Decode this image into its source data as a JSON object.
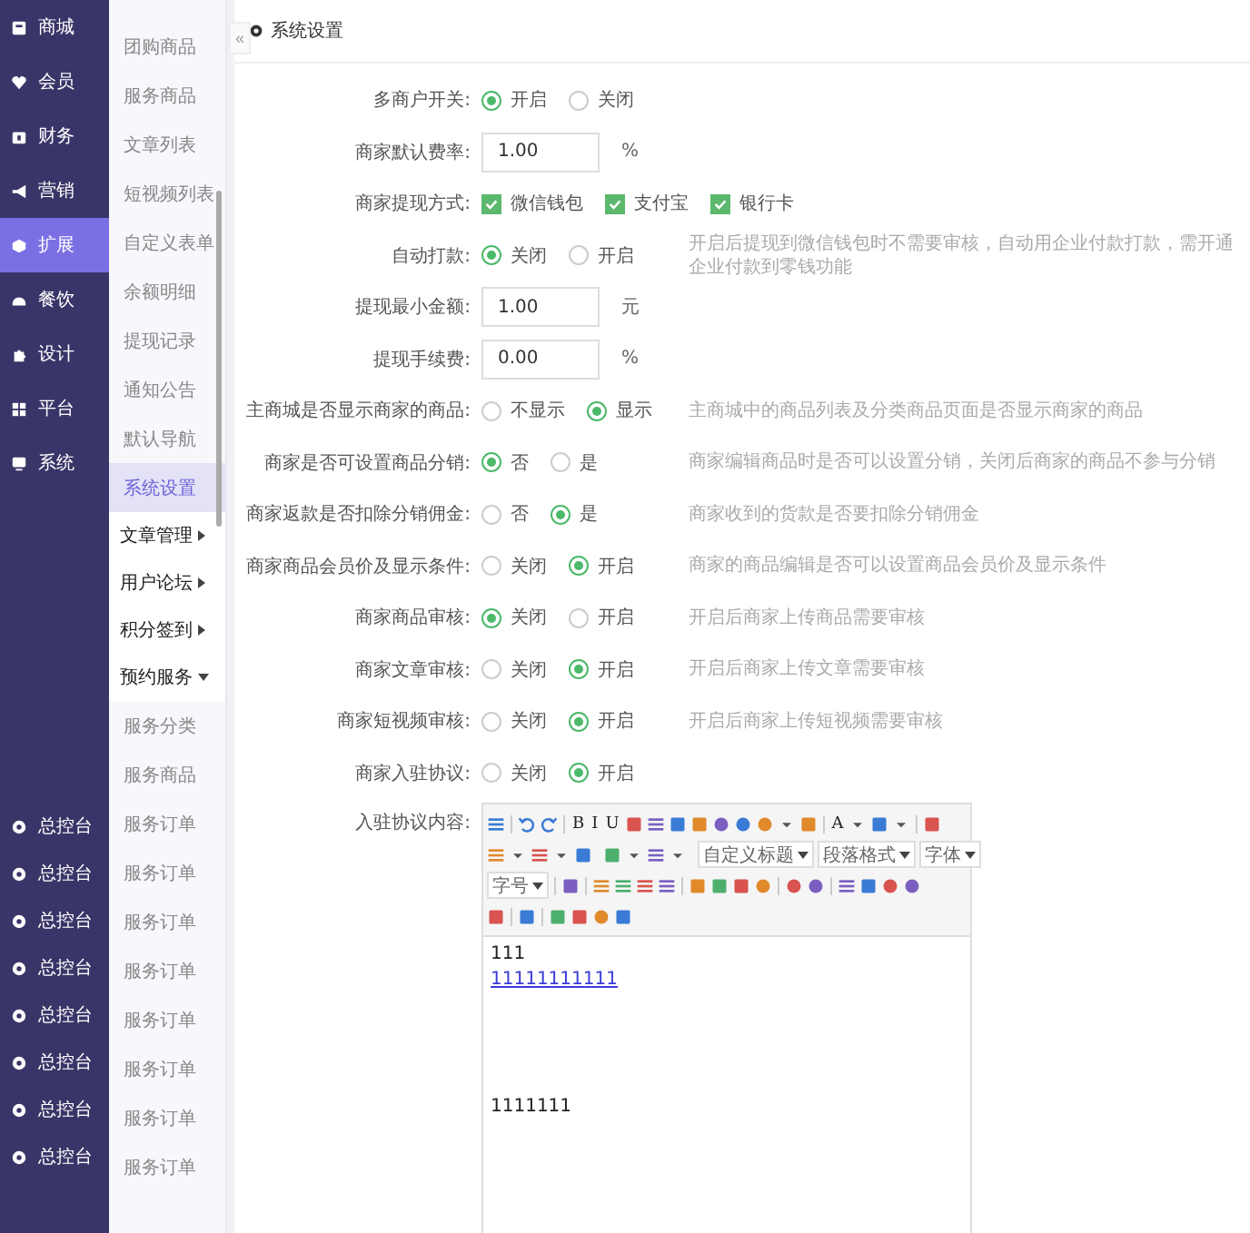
{
  "sidebar": {
    "items": [
      {
        "label": "商城",
        "selected": false
      },
      {
        "label": "会员",
        "selected": false
      },
      {
        "label": "财务",
        "selected": false
      },
      {
        "label": "营销",
        "selected": false
      },
      {
        "label": "扩展",
        "selected": true
      },
      {
        "label": "餐饮",
        "selected": false
      },
      {
        "label": "设计",
        "selected": false
      },
      {
        "label": "平台",
        "selected": false
      },
      {
        "label": "系统",
        "selected": false
      }
    ],
    "bottom_items": [
      {
        "label": "总控台"
      },
      {
        "label": "总控台"
      },
      {
        "label": "总控台"
      },
      {
        "label": "总控台"
      },
      {
        "label": "总控台"
      },
      {
        "label": "总控台"
      },
      {
        "label": "总控台"
      },
      {
        "label": "总控台"
      }
    ]
  },
  "submenu": {
    "collapse_button": "«",
    "items": [
      {
        "label": "团购商品",
        "kind": "link",
        "selected": false
      },
      {
        "label": "服务商品",
        "kind": "link",
        "selected": false
      },
      {
        "label": "文章列表",
        "kind": "link",
        "selected": false
      },
      {
        "label": "短视频列表",
        "kind": "link",
        "selected": false
      },
      {
        "label": "自定义表单",
        "kind": "link",
        "selected": false
      },
      {
        "label": "余额明细",
        "kind": "link",
        "selected": false
      },
      {
        "label": "提现记录",
        "kind": "link",
        "selected": false
      },
      {
        "label": "通知公告",
        "kind": "link",
        "selected": false
      },
      {
        "label": "默认导航",
        "kind": "link",
        "selected": false
      },
      {
        "label": "系统设置",
        "kind": "link",
        "selected": true
      },
      {
        "label": "文章管理",
        "kind": "group",
        "expanded": false
      },
      {
        "label": "用户论坛",
        "kind": "group",
        "expanded": false
      },
      {
        "label": "积分签到",
        "kind": "group",
        "expanded": false
      },
      {
        "label": "预约服务",
        "kind": "group",
        "expanded": true
      },
      {
        "label": "服务分类",
        "kind": "link",
        "selected": false
      },
      {
        "label": "服务商品",
        "kind": "link",
        "selected": false
      },
      {
        "label": "服务订单",
        "kind": "link",
        "selected": false
      },
      {
        "label": "服务订单",
        "kind": "link",
        "selected": false
      },
      {
        "label": "服务订单",
        "kind": "link",
        "selected": false
      },
      {
        "label": "服务订单",
        "kind": "link",
        "selected": false
      },
      {
        "label": "服务订单",
        "kind": "link",
        "selected": false
      },
      {
        "label": "服务订单",
        "kind": "link",
        "selected": false
      },
      {
        "label": "服务订单",
        "kind": "link",
        "selected": false
      },
      {
        "label": "服务订单",
        "kind": "link",
        "selected": false
      }
    ]
  },
  "panel": {
    "title": "系统设置"
  },
  "form": [
    {
      "kind": "radio",
      "label": "多商户开关:",
      "options": [
        {
          "label": "开启",
          "selected": true
        },
        {
          "label": "关闭",
          "selected": false
        }
      ]
    },
    {
      "kind": "input",
      "label": "商家默认费率:",
      "value": "1.00",
      "unit": "%"
    },
    {
      "kind": "checkbox",
      "label": "商家提现方式:",
      "options": [
        {
          "label": "微信钱包",
          "checked": true
        },
        {
          "label": "支付宝",
          "checked": true
        },
        {
          "label": "银行卡",
          "checked": true
        }
      ]
    },
    {
      "kind": "radio",
      "label": "自动打款:",
      "options": [
        {
          "label": "关闭",
          "selected": true
        },
        {
          "label": "开启",
          "selected": false
        }
      ],
      "help": "开启后提现到微信钱包时不需要审核，自动用企业付款打款，需开通企业付款到零钱功能"
    },
    {
      "kind": "input",
      "label": "提现最小金额:",
      "value": "1.00",
      "unit": "元"
    },
    {
      "kind": "input",
      "label": "提现手续费:",
      "value": "0.00",
      "unit": "%"
    },
    {
      "kind": "radio",
      "label": "主商城是否显示商家的商品:",
      "options": [
        {
          "label": "不显示",
          "selected": false
        },
        {
          "label": "显示",
          "selected": true
        }
      ],
      "help": "主商城中的商品列表及分类商品页面是否显示商家的商品"
    },
    {
      "kind": "radio",
      "label": "商家是否可设置商品分销:",
      "options": [
        {
          "label": "否",
          "selected": true
        },
        {
          "label": "是",
          "selected": false
        }
      ],
      "help": "商家编辑商品时是否可以设置分销，关闭后商家的商品不参与分销"
    },
    {
      "kind": "radio",
      "label": "商家返款是否扣除分销佣金:",
      "options": [
        {
          "label": "否",
          "selected": false
        },
        {
          "label": "是",
          "selected": true
        }
      ],
      "help": "商家收到的货款是否要扣除分销佣金"
    },
    {
      "kind": "radio",
      "label": "商家商品会员价及显示条件:",
      "options": [
        {
          "label": "关闭",
          "selected": false
        },
        {
          "label": "开启",
          "selected": true
        }
      ],
      "help": "商家的商品编辑是否可以设置商品会员价及显示条件"
    },
    {
      "kind": "radio",
      "label": "商家商品审核:",
      "options": [
        {
          "label": "关闭",
          "selected": true
        },
        {
          "label": "开启",
          "selected": false
        }
      ],
      "help": "开启后商家上传商品需要审核"
    },
    {
      "kind": "radio",
      "label": "商家文章审核:",
      "options": [
        {
          "label": "关闭",
          "selected": false
        },
        {
          "label": "开启",
          "selected": true
        }
      ],
      "help": "开启后商家上传文章需要审核"
    },
    {
      "kind": "radio",
      "label": "商家短视频审核:",
      "options": [
        {
          "label": "关闭",
          "selected": false
        },
        {
          "label": "开启",
          "selected": true
        }
      ],
      "help": "开启后商家上传短视频需要审核"
    },
    {
      "kind": "radio",
      "label": "商家入驻协议:",
      "options": [
        {
          "label": "关闭",
          "selected": false
        },
        {
          "label": "开启",
          "selected": true
        }
      ]
    },
    {
      "kind": "editor",
      "label": "入驻协议内容:",
      "toolbar_text": [
        "B",
        "I",
        "U",
        "A"
      ],
      "selects": [
        "自定义标题",
        "段落格式",
        "字体",
        "字号"
      ],
      "content": [
        {
          "kind": "text",
          "text": "111"
        },
        {
          "kind": "link",
          "text": "11111111111"
        },
        {
          "kind": "blank"
        },
        {
          "kind": "blank"
        },
        {
          "kind": "blank"
        },
        {
          "kind": "blank"
        },
        {
          "kind": "text",
          "text": "1111111"
        }
      ]
    }
  ]
}
